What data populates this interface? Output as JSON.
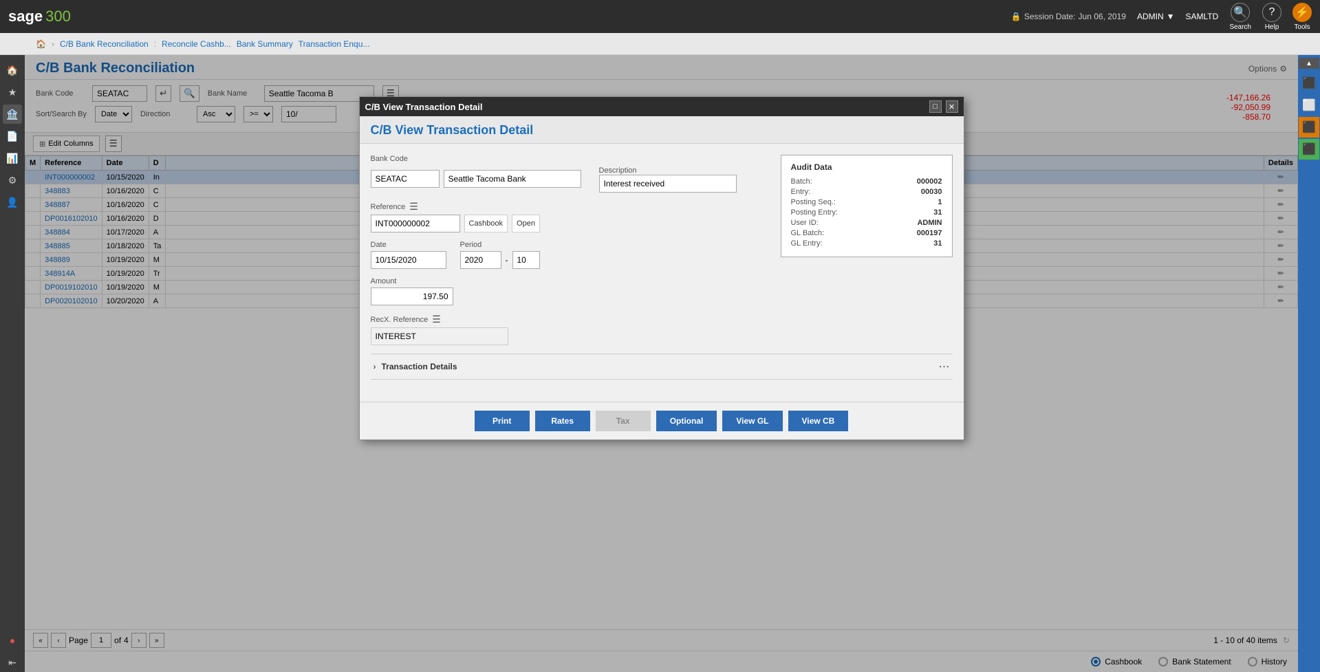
{
  "app": {
    "logo_text": "sage",
    "logo_300": "300"
  },
  "topbar": {
    "session_label": "Session Date:",
    "session_date": "Jun 06, 2019",
    "admin_label": "ADMIN",
    "company": "SAMLTD",
    "search_label": "Search",
    "help_label": "Help",
    "tools_label": "Tools"
  },
  "breadcrumb": {
    "items": [
      {
        "text": "C/B Bank Reconciliation",
        "link": true
      },
      {
        "text": "Reconcile Cashb...",
        "link": true
      },
      {
        "text": "Bank Summary",
        "link": true
      },
      {
        "text": "Transaction Enqu...",
        "link": true
      }
    ]
  },
  "page": {
    "title": "C/B Bank Reconciliation",
    "options_label": "Options"
  },
  "bank": {
    "code_label": "Bank Code",
    "name_label": "Bank Name",
    "code_value": "SEATAC",
    "name_value": "Seattle Tacoma B"
  },
  "sort_search": {
    "label": "Sort/Search By",
    "direction_label": "Direction",
    "sort_value": "Date",
    "direction_value": "Asc",
    "operator_value": ">=",
    "date_value": "10/"
  },
  "toolbar": {
    "edit_columns_label": "Edit Columns"
  },
  "table": {
    "headers": [
      "M",
      "Reference",
      "Date",
      "D"
    ],
    "rows": [
      {
        "m": "",
        "reference": "INT000000002",
        "date": "10/15/2020",
        "d": "In",
        "selected": true
      },
      {
        "m": "",
        "reference": "348883",
        "date": "10/16/2020",
        "d": "C"
      },
      {
        "m": "",
        "reference": "348887",
        "date": "10/16/2020",
        "d": "C"
      },
      {
        "m": "",
        "reference": "DP0016102010",
        "date": "10/16/2020",
        "d": "D"
      },
      {
        "m": "",
        "reference": "348884",
        "date": "10/17/2020",
        "d": "A"
      },
      {
        "m": "",
        "reference": "348885",
        "date": "10/18/2020",
        "d": "Ta"
      },
      {
        "m": "",
        "reference": "348889",
        "date": "10/19/2020",
        "d": "M"
      },
      {
        "m": "",
        "reference": "348914A",
        "date": "10/19/2020",
        "d": "Tr"
      },
      {
        "m": "",
        "reference": "DP0019102010",
        "date": "10/19/2020",
        "d": "M"
      },
      {
        "m": "",
        "reference": "DP0020102010",
        "date": "10/20/2020",
        "d": "A"
      }
    ],
    "details_col": "Details"
  },
  "pagination": {
    "prev_prev_label": "«",
    "prev_label": "‹",
    "next_label": "›",
    "next_next_label": "»",
    "page_label": "Page",
    "current_page": "1",
    "total_pages": "4",
    "items_info": "1 - 10 of 40 items"
  },
  "summary": {
    "amount1": "-147,166.26",
    "amount2": "-92,050.99",
    "amount3": "-858.70"
  },
  "radio_options": {
    "cashbook_label": "Cashbook",
    "bank_statement_label": "Bank Statement",
    "history_label": "History",
    "selected": "cashbook"
  },
  "modal": {
    "title": "C/B View Transaction Detail",
    "bank_code_label": "Bank Code",
    "bank_code_value": "SEATAC",
    "bank_name_value": "Seattle Tacoma Bank",
    "description_label": "Description",
    "description_value": "Interest received",
    "reference_label": "Reference",
    "reference_value": "INT000000002",
    "cashbook_tag": "Cashbook",
    "open_tag": "Open",
    "date_label": "Date",
    "date_value": "10/15/2020",
    "period_label": "Period",
    "period_year": "2020",
    "period_dash": "-",
    "period_month": "10",
    "amount_label": "Amount",
    "amount_value": "197.50",
    "recx_ref_label": "RecX. Reference",
    "recx_ref_value": "INTEREST",
    "audit": {
      "title": "Audit Data",
      "batch_label": "Batch:",
      "batch_value": "000002",
      "entry_label": "Entry:",
      "entry_value": "00030",
      "posting_seq_label": "Posting Seq.:",
      "posting_seq_value": "1",
      "posting_entry_label": "Posting Entry:",
      "posting_entry_value": "31",
      "user_id_label": "User ID:",
      "user_id_value": "ADMIN",
      "gl_batch_label": "GL Batch:",
      "gl_batch_value": "000197",
      "gl_entry_label": "GL Entry:",
      "gl_entry_value": "31"
    },
    "transaction_details_label": "Transaction Details",
    "buttons": {
      "print": "Print",
      "rates": "Rates",
      "tax": "Tax",
      "optional": "Optional",
      "view_gl": "View GL",
      "view_cb": "View CB"
    }
  }
}
